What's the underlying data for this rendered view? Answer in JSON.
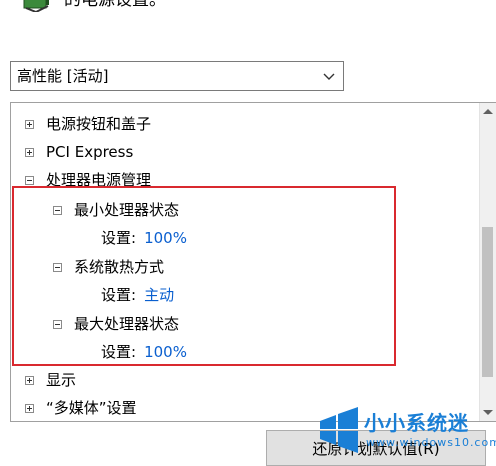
{
  "header": {
    "text": "的电源设置。",
    "icon": "battery-plug-icon"
  },
  "plan_select": {
    "selected": "高性能 [活动]",
    "icon": "chevron-down-icon"
  },
  "tree": {
    "items": [
      {
        "label": "电源按钮和盖子",
        "toggle": "plus"
      },
      {
        "label": "PCI Express",
        "toggle": "plus"
      },
      {
        "label": "处理器电源管理",
        "toggle": "minus"
      },
      {
        "label": "最小处理器状态",
        "toggle": "minus",
        "setting_label": "设置:",
        "setting_value": "100%"
      },
      {
        "label": "系统散热方式",
        "toggle": "minus",
        "setting_label": "设置:",
        "setting_value": "主动"
      },
      {
        "label": "最大处理器状态",
        "toggle": "minus",
        "setting_label": "设置:",
        "setting_value": "100%"
      },
      {
        "label": "显示",
        "toggle": "plus"
      },
      {
        "label": "“多媒体”设置",
        "toggle": "plus"
      }
    ]
  },
  "restore_button": {
    "label": "还原计划默认值(R)"
  },
  "watermark": {
    "title": "小小系统迷",
    "url": "www.windows10.com"
  },
  "colors": {
    "highlight": "#d9292f",
    "setting_value": "#0a5fcf",
    "watermark": "#1a7fd6"
  }
}
